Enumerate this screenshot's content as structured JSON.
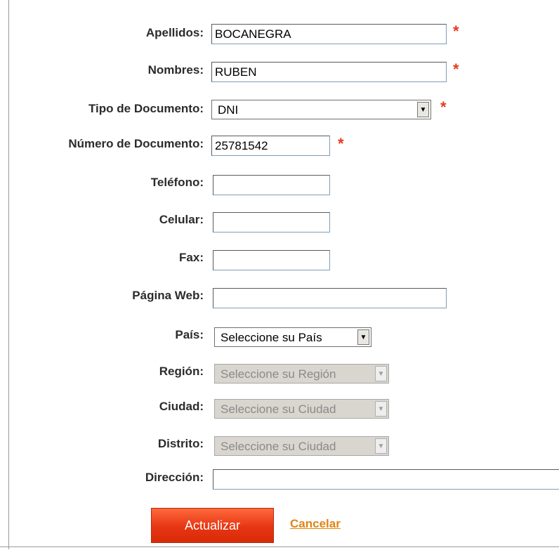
{
  "form": {
    "apellidos": {
      "label": "Apellidos:",
      "value": "BOCANEGRA",
      "required": "*"
    },
    "nombres": {
      "label": "Nombres:",
      "value": "RUBEN",
      "required": "*"
    },
    "tipo_documento": {
      "label": "Tipo de Documento:",
      "value": "DNI",
      "required": "*"
    },
    "numero_documento": {
      "label": "Número de Documento:",
      "value": "25781542",
      "required": "*"
    },
    "telefono": {
      "label": "Teléfono:",
      "value": ""
    },
    "celular": {
      "label": "Celular:",
      "value": ""
    },
    "fax": {
      "label": "Fax:",
      "value": ""
    },
    "pagina_web": {
      "label": "Página Web:",
      "value": ""
    },
    "pais": {
      "label": "País:",
      "value": "Seleccione su País"
    },
    "region": {
      "label": "Región:",
      "value": "Seleccione su Región"
    },
    "ciudad": {
      "label": "Ciudad:",
      "value": "Seleccione su Ciudad"
    },
    "distrito": {
      "label": "Distrito:",
      "value": "Seleccione su Ciudad"
    },
    "direccion": {
      "label": "Dirección:",
      "value": ""
    }
  },
  "actions": {
    "update_label": "Actualizar",
    "cancel_label": "Cancelar"
  },
  "colors": {
    "required": "#e8391c",
    "button": "#e63512",
    "link": "#e08412"
  },
  "icons": {
    "dropdown": "chevron-down-icon"
  }
}
